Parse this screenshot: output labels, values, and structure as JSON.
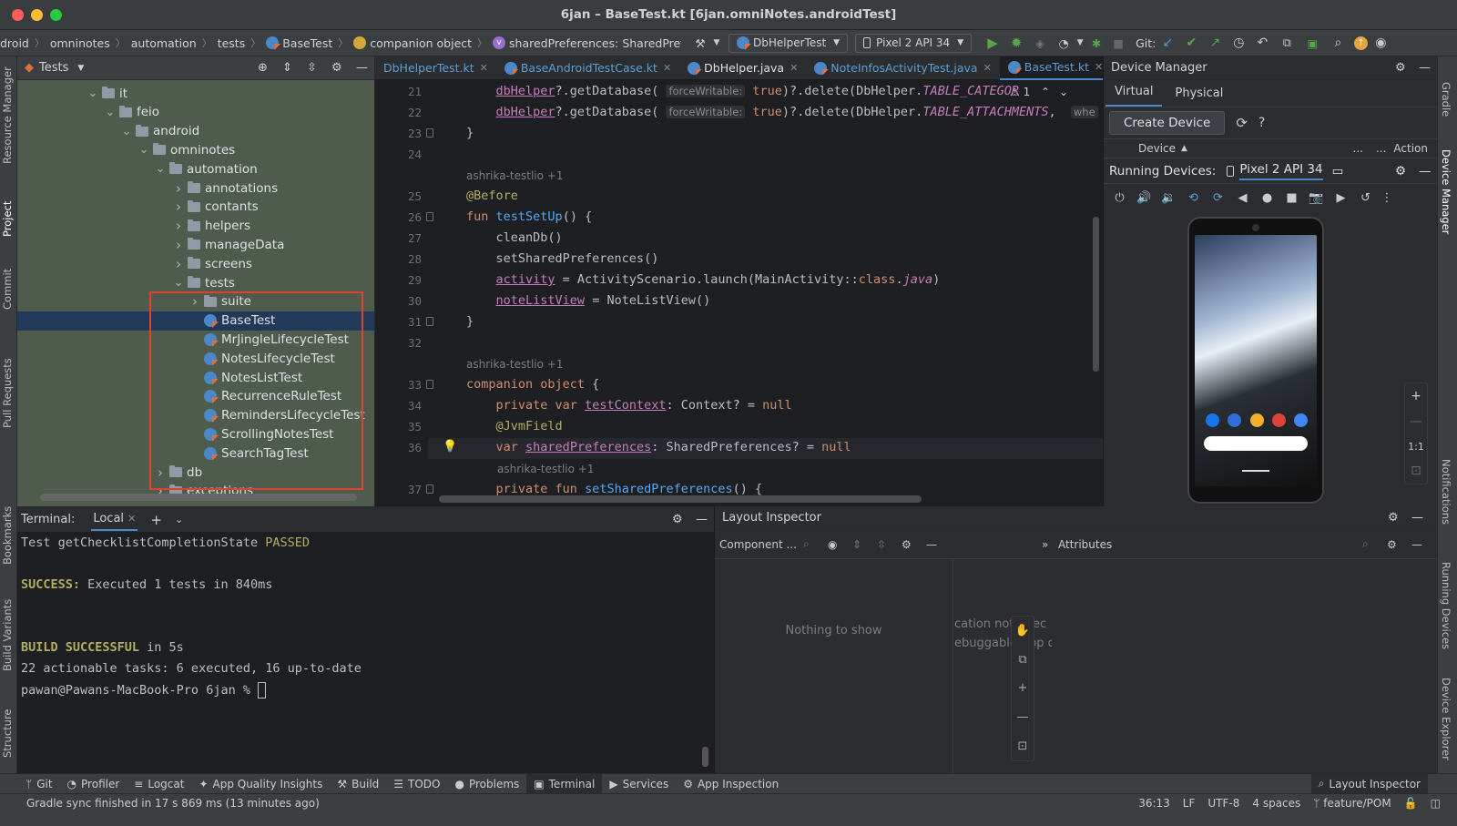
{
  "window": {
    "title": "6jan – BaseTest.kt [6jan.omniNotes.androidTest]"
  },
  "breadcrumbs": [
    "droid",
    "omninotes",
    "automation",
    "tests",
    "BaseTest",
    "companion object",
    "sharedPreferences: SharedPreferences?"
  ],
  "toolbar": {
    "config": "DbHelperTest",
    "device": "Pixel 2 API 34",
    "git_label": "Git:"
  },
  "left_tools": [
    "Resource Manager",
    "Project",
    "Commit",
    "Pull Requests",
    "Bookmarks",
    "Build Variants",
    "Structure"
  ],
  "right_tools": [
    "Gradle",
    "Device Manager",
    "Notifications",
    "Running Devices",
    "Device Explorer"
  ],
  "project": {
    "view": "Tests",
    "tree": [
      {
        "label": "it",
        "depth": 0,
        "type": "folder",
        "open": true
      },
      {
        "label": "feio",
        "depth": 1,
        "type": "folder",
        "open": true
      },
      {
        "label": "android",
        "depth": 2,
        "type": "folder",
        "open": true
      },
      {
        "label": "omninotes",
        "depth": 3,
        "type": "folder",
        "open": true
      },
      {
        "label": "automation",
        "depth": 4,
        "type": "folder",
        "open": true
      },
      {
        "label": "annotations",
        "depth": 5,
        "type": "folder",
        "open": false
      },
      {
        "label": "contants",
        "depth": 5,
        "type": "folder",
        "open": false
      },
      {
        "label": "helpers",
        "depth": 5,
        "type": "folder",
        "open": false
      },
      {
        "label": "manageData",
        "depth": 5,
        "type": "folder",
        "open": false
      },
      {
        "label": "screens",
        "depth": 5,
        "type": "folder",
        "open": false
      },
      {
        "label": "tests",
        "depth": 5,
        "type": "folder",
        "open": true
      },
      {
        "label": "suite",
        "depth": 6,
        "type": "folder",
        "open": false
      },
      {
        "label": "BaseTest",
        "depth": 6,
        "type": "class",
        "selected": true
      },
      {
        "label": "MrJingleLifecycleTest",
        "depth": 6,
        "type": "class"
      },
      {
        "label": "NotesLifecycleTest",
        "depth": 6,
        "type": "class"
      },
      {
        "label": "NotesListTest",
        "depth": 6,
        "type": "class"
      },
      {
        "label": "RecurrenceRuleTest",
        "depth": 6,
        "type": "class"
      },
      {
        "label": "RemindersLifecycleTest",
        "depth": 6,
        "type": "class"
      },
      {
        "label": "ScrollingNotesTest",
        "depth": 6,
        "type": "class"
      },
      {
        "label": "SearchTagTest",
        "depth": 6,
        "type": "class"
      },
      {
        "label": "db",
        "depth": 4,
        "type": "folder",
        "open": false
      },
      {
        "label": "exceptions",
        "depth": 4,
        "type": "folder",
        "open": false
      }
    ]
  },
  "editor": {
    "tabs": [
      {
        "label": "DbHelperTest.kt",
        "active": false
      },
      {
        "label": "BaseAndroidTestCase.kt",
        "active": false
      },
      {
        "label": "DbHelper.java",
        "active": false
      },
      {
        "label": "NoteInfosActivityTest.java",
        "active": false
      },
      {
        "label": "BaseTest.kt",
        "active": true
      }
    ],
    "warning_count": "1",
    "lines": [
      {
        "n": "21",
        "html": "    <span class='prop'>dbHelper</span>?.getDatabase( <span class='hint'>forceWritable:</span> <span class='kw'>true</span>)?.delete(DbHelper.<span class='it'>TABLE_CATEGOR</span>"
      },
      {
        "n": "22",
        "html": "    <span class='prop'>dbHelper</span>?.getDatabase( <span class='hint'>forceWritable:</span> <span class='kw'>true</span>)?.delete(DbHelper.<span class='it'>TABLE_ATTACHMENTS</span>,  <span class='hint'>whe</span>"
      },
      {
        "n": "23",
        "html": "}"
      },
      {
        "n": "24",
        "html": ""
      },
      {
        "ann": "ashrika-testlio +1"
      },
      {
        "n": "25",
        "html": "<span class='an'>@Before</span>"
      },
      {
        "n": "26",
        "html": "<span class='kw'>fun</span> <span class='fn'>testSetUp</span>() {"
      },
      {
        "n": "27",
        "html": "    cleanDb()"
      },
      {
        "n": "28",
        "html": "    setSharedPreferences()"
      },
      {
        "n": "29",
        "html": "    <span class='prop'>activity</span> = ActivityScenario.launch(MainActivity::<span class='kw'>class</span>.<span class='it'>java</span>)"
      },
      {
        "n": "30",
        "html": "    <span class='prop'>noteListView</span> = NoteListView()"
      },
      {
        "n": "31",
        "html": "}"
      },
      {
        "n": "32",
        "html": ""
      },
      {
        "ann": "ashrika-testlio +1"
      },
      {
        "n": "33",
        "html": "<span class='kw'>companion object</span> {"
      },
      {
        "n": "34",
        "html": "    <span class='kw'>private var</span> <span class='prop'>testContext</span>: Context? = <span class='kw'>null</span>"
      },
      {
        "n": "35",
        "html": "    <span class='an'>@JvmField</span>"
      },
      {
        "n": "36",
        "html": "    <span class='kw'>var</span> <span class='prop'>sharedPreferences</span>: SharedPreferences? = <span class='kw'>null</span>"
      },
      {
        "ann2": "ashrika-testlio +1"
      },
      {
        "n": "37",
        "html": "    <span class='kw'>private fun</span> <span class='fn'>setSharedPreferences</span>() {"
      }
    ]
  },
  "device_manager": {
    "title": "Device Manager",
    "tab_virtual": "Virtual",
    "tab_physical": "Physical",
    "create_device": "Create Device",
    "col_device": "Device",
    "col_action": "Action",
    "running_label": "Running Devices:",
    "running_device": "Pixel 2 API 34",
    "zoom_label": "1:1"
  },
  "terminal": {
    "label": "Terminal:",
    "tab": "Local",
    "lines": [
      {
        "parts": [
          {
            "t": "Test getChecklistCompletionState ",
            "c": "#bcbec4"
          },
          {
            "t": "PASSED",
            "c": "#b3ae60"
          }
        ]
      },
      {
        "parts": [
          {
            "t": "",
            "c": "#bcbec4"
          }
        ]
      },
      {
        "parts": [
          {
            "t": "SUCCESS: ",
            "c": "#b3ae60"
          },
          {
            "t": "Executed 1 tests in 840ms",
            "c": "#bcbec4"
          }
        ]
      },
      {
        "parts": [
          {
            "t": "",
            "c": "#bcbec4"
          }
        ]
      },
      {
        "parts": [
          {
            "t": "",
            "c": "#bcbec4"
          }
        ]
      },
      {
        "parts": [
          {
            "t": "BUILD SUCCESSFUL",
            "c": "#b3ae60"
          },
          {
            "t": " in 5s",
            "c": "#bcbec4"
          }
        ]
      },
      {
        "parts": [
          {
            "t": "22 actionable tasks: 6 executed, 16 up-to-date",
            "c": "#bcbec4"
          }
        ]
      },
      {
        "parts": [
          {
            "t": "pawan@Pawans-MacBook-Pro 6jan % ",
            "c": "#bcbec4"
          }
        ]
      }
    ]
  },
  "layout_inspector": {
    "title": "Layout Inspector",
    "component_tree": "Component ...",
    "attributes": "Attributes",
    "empty": "Nothing to show",
    "msg1": "cation not",
    "msg1b": "ec",
    "msg2": "ebuggable",
    "msg2b": "app or"
  },
  "bottom_tools": [
    "Git",
    "Profiler",
    "Logcat",
    "App Quality Insights",
    "Build",
    "TODO",
    "Problems",
    "Terminal",
    "Services",
    "App Inspection"
  ],
  "bottom_active": "Terminal",
  "bottom_right": "Layout Inspector",
  "status": {
    "message": "Gradle sync finished in 17 s 869 ms (13 minutes ago)",
    "position": "36:13",
    "line_sep": "LF",
    "encoding": "UTF-8",
    "indent": "4 spaces",
    "branch": "feature/POM"
  }
}
